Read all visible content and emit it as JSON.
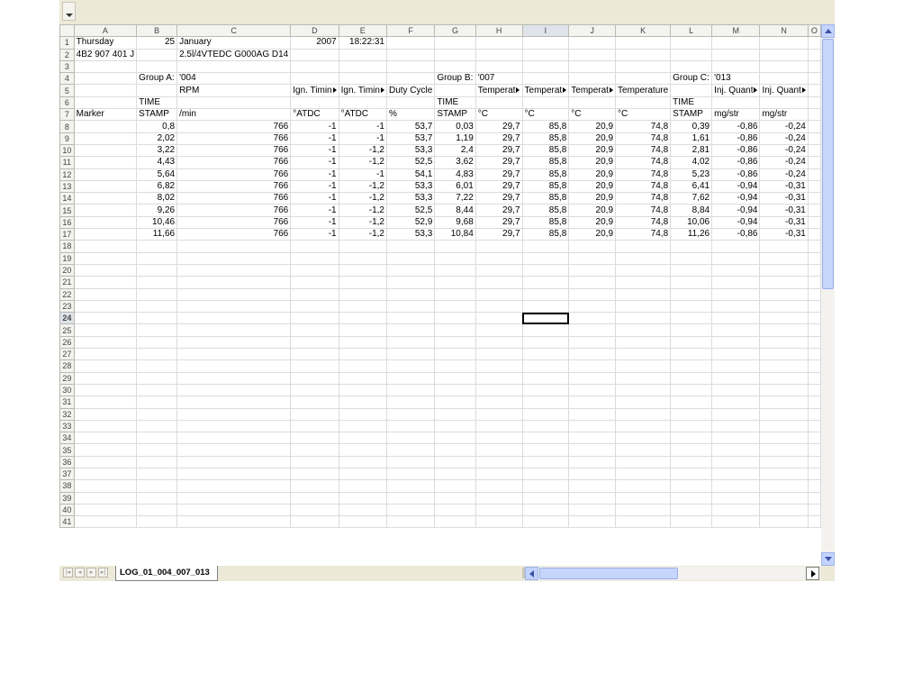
{
  "columns": [
    "A",
    "B",
    "C",
    "D",
    "E",
    "F",
    "G",
    "H",
    "I",
    "J",
    "K",
    "L",
    "M",
    "N",
    "O"
  ],
  "selected_column": "I",
  "selected_row": 24,
  "active_cell": "I24",
  "row_count": 41,
  "cells": {
    "1": {
      "A": "Thursday",
      "B": "25",
      "C": "January",
      "D": "2007",
      "E": "18:22:31"
    },
    "2": {
      "A": "4B2 907 401 J",
      "C": "2.5l/4VTEDC G000AG D14"
    },
    "4": {
      "B": "Group A:",
      "C": "'004",
      "G": "Group B:",
      "H": "'007",
      "L": "Group C:",
      "M": "'013"
    },
    "5": {
      "C": "RPM",
      "D": "Ign. Timin",
      "E": "Ign. Timin",
      "F": "Duty Cycle",
      "H": "Temperat",
      "I": "Temperat",
      "J": "Temperat",
      "K": "Temperature",
      "M": "Inj. Quant",
      "N": "Inj. Quant"
    },
    "6": {
      "B": "TIME",
      "G": "TIME",
      "L": "TIME"
    },
    "7": {
      "A": "Marker",
      "B": "STAMP",
      "C": "/min",
      "D": "°ATDC",
      "E": "°ATDC",
      "F": "%",
      "G": "STAMP",
      "H": "°C",
      "I": "°C",
      "J": "°C",
      "K": "°C",
      "L": "STAMP",
      "M": "mg/str",
      "N": "mg/str"
    },
    "8": {
      "B": "0,8",
      "C": "766",
      "D": "-1",
      "E": "-1",
      "F": "53,7",
      "G": "0,03",
      "H": "29,7",
      "I": "85,8",
      "J": "20,9",
      "K": "74,8",
      "L": "0,39",
      "M": "-0,86",
      "N": "-0,24"
    },
    "9": {
      "B": "2,02",
      "C": "766",
      "D": "-1",
      "E": "-1",
      "F": "53,7",
      "G": "1,19",
      "H": "29,7",
      "I": "85,8",
      "J": "20,9",
      "K": "74,8",
      "L": "1,61",
      "M": "-0,86",
      "N": "-0,24"
    },
    "10": {
      "B": "3,22",
      "C": "766",
      "D": "-1",
      "E": "-1,2",
      "F": "53,3",
      "G": "2,4",
      "H": "29,7",
      "I": "85,8",
      "J": "20,9",
      "K": "74,8",
      "L": "2,81",
      "M": "-0,86",
      "N": "-0,24"
    },
    "11": {
      "B": "4,43",
      "C": "766",
      "D": "-1",
      "E": "-1,2",
      "F": "52,5",
      "G": "3,62",
      "H": "29,7",
      "I": "85,8",
      "J": "20,9",
      "K": "74,8",
      "L": "4,02",
      "M": "-0,86",
      "N": "-0,24"
    },
    "12": {
      "B": "5,64",
      "C": "766",
      "D": "-1",
      "E": "-1",
      "F": "54,1",
      "G": "4,83",
      "H": "29,7",
      "I": "85,8",
      "J": "20,9",
      "K": "74,8",
      "L": "5,23",
      "M": "-0,86",
      "N": "-0,24"
    },
    "13": {
      "B": "6,82",
      "C": "766",
      "D": "-1",
      "E": "-1,2",
      "F": "53,3",
      "G": "6,01",
      "H": "29,7",
      "I": "85,8",
      "J": "20,9",
      "K": "74,8",
      "L": "6,41",
      "M": "-0,94",
      "N": "-0,31"
    },
    "14": {
      "B": "8,02",
      "C": "766",
      "D": "-1",
      "E": "-1,2",
      "F": "53,3",
      "G": "7,22",
      "H": "29,7",
      "I": "85,8",
      "J": "20,9",
      "K": "74,8",
      "L": "7,62",
      "M": "-0,94",
      "N": "-0,31"
    },
    "15": {
      "B": "9,26",
      "C": "766",
      "D": "-1",
      "E": "-1,2",
      "F": "52,5",
      "G": "8,44",
      "H": "29,7",
      "I": "85,8",
      "J": "20,9",
      "K": "74,8",
      "L": "8,84",
      "M": "-0,94",
      "N": "-0,31"
    },
    "16": {
      "B": "10,46",
      "C": "766",
      "D": "-1",
      "E": "-1,2",
      "F": "52,9",
      "G": "9,68",
      "H": "29,7",
      "I": "85,8",
      "J": "20,9",
      "K": "74,8",
      "L": "10,06",
      "M": "-0,94",
      "N": "-0,31"
    },
    "17": {
      "B": "11,66",
      "C": "766",
      "D": "-1",
      "E": "-1,2",
      "F": "53,3",
      "G": "10,84",
      "H": "29,7",
      "I": "85,8",
      "J": "20,9",
      "K": "74,8",
      "L": "11,26",
      "M": "-0,86",
      "N": "-0,31"
    }
  },
  "right_aligned": {
    "1": [
      "B",
      "D",
      "E"
    ],
    "8-17": [
      "B",
      "C",
      "D",
      "E",
      "F",
      "G",
      "H",
      "I",
      "J",
      "K",
      "L",
      "M",
      "N"
    ]
  },
  "overflow_markers": {
    "5": [
      "D",
      "E",
      "H",
      "I",
      "J",
      "M",
      "N"
    ]
  },
  "sheet_tab": "LOG_01_004_007_013",
  "icons": {
    "namebox": "dropdown-arrow-icon",
    "first_sheet": "first-sheet-icon",
    "prev_sheet": "previous-sheet-icon",
    "next_sheet": "next-sheet-icon",
    "last_sheet": "last-sheet-icon"
  }
}
